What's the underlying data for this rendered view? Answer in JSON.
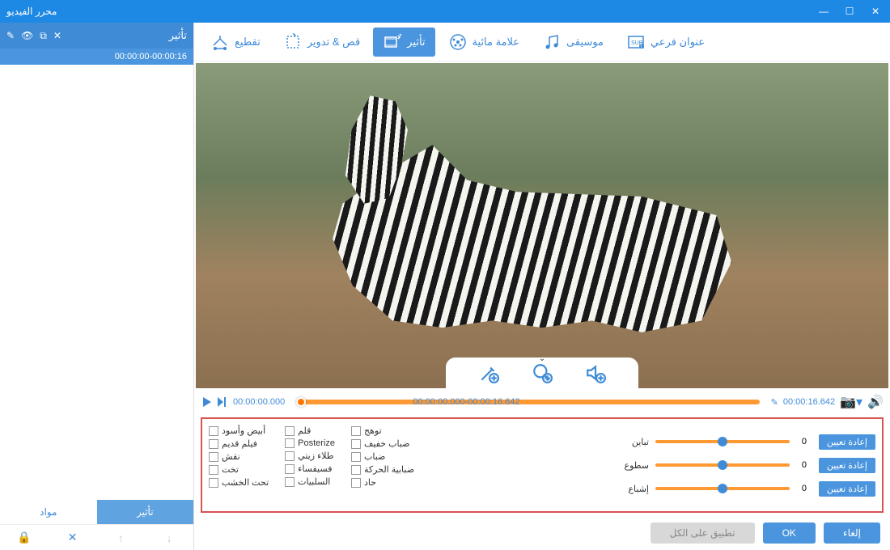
{
  "window": {
    "title": "محرر الفيديو"
  },
  "sidebar": {
    "header_label": "تأثير",
    "clip_time": "00:00:00-00:00:16",
    "tabs": [
      {
        "label": "مواد"
      },
      {
        "label": "تأثير"
      }
    ]
  },
  "toolbar": {
    "items": [
      {
        "label": "تقطيع"
      },
      {
        "label": "قص & تدوير"
      },
      {
        "label": "تأثير"
      },
      {
        "label": "علامة مائية"
      },
      {
        "label": "موسيقى"
      },
      {
        "label": "عنوان فرعي"
      }
    ]
  },
  "timeline": {
    "start": "00:00:00.000",
    "range": "00:00:00.000-00:00:16.642",
    "end": "00:00:16.642"
  },
  "effects": {
    "cols": [
      [
        "أبيض وأسود",
        "فيلم قديم",
        "نقش",
        "تخت",
        "تحت الخشب"
      ],
      [
        "قلم",
        "Posterize",
        "طلاء زيتي",
        "فسيفساء",
        "السلبيات"
      ],
      [
        "توهج",
        "ضباب خفيف",
        "ضباب",
        "ضبابية الحركة",
        "حاد"
      ]
    ]
  },
  "sliders": [
    {
      "label": "تباين",
      "value": "0",
      "reset": "إعادة تعيين"
    },
    {
      "label": "سطوع",
      "value": "0",
      "reset": "إعادة تعيين"
    },
    {
      "label": "إشباع",
      "value": "0",
      "reset": "إعادة تعيين"
    }
  ],
  "buttons": {
    "apply_all": "تطبيق على الكل",
    "ok": "OK",
    "cancel": "إلغاء"
  }
}
